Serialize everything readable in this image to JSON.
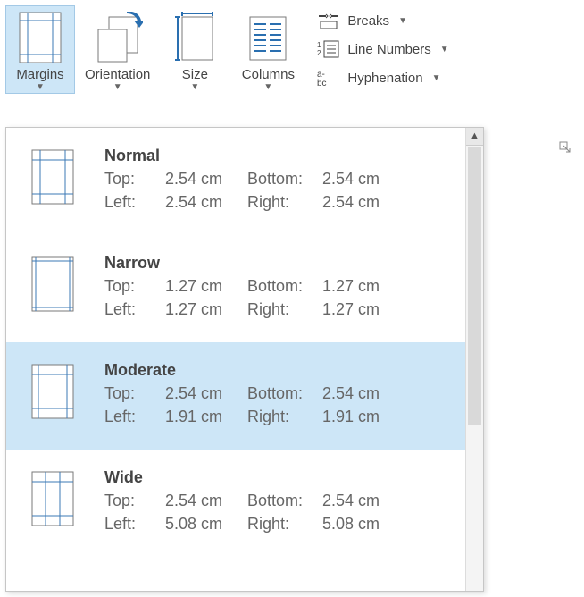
{
  "ribbon": {
    "margins": "Margins",
    "orientation": "Orientation",
    "size": "Size",
    "columns": "Columns",
    "breaks": "Breaks",
    "lineNumbers": "Line Numbers",
    "hyphenation": "Hyphenation"
  },
  "presets": [
    {
      "name": "Normal",
      "top": "2.54 cm",
      "bottom": "2.54 cm",
      "left": "2.54 cm",
      "right": "2.54 cm",
      "hover": false,
      "m": {
        "t": 12,
        "b": 12,
        "l": 10,
        "r": 10
      }
    },
    {
      "name": "Narrow",
      "top": "1.27 cm",
      "bottom": "1.27 cm",
      "left": "1.27 cm",
      "right": "1.27 cm",
      "hover": false,
      "m": {
        "t": 5,
        "b": 5,
        "l": 5,
        "r": 5
      }
    },
    {
      "name": "Moderate",
      "top": "2.54 cm",
      "bottom": "2.54 cm",
      "left": "1.91 cm",
      "right": "1.91 cm",
      "hover": true,
      "m": {
        "t": 12,
        "b": 12,
        "l": 8,
        "r": 8
      }
    },
    {
      "name": "Wide",
      "top": "2.54 cm",
      "bottom": "2.54 cm",
      "left": "5.08 cm",
      "right": "5.08 cm",
      "hover": false,
      "m": {
        "t": 12,
        "b": 12,
        "l": 16,
        "r": 16
      }
    }
  ],
  "labels": {
    "top": "Top:",
    "bottom": "Bottom:",
    "left": "Left:",
    "right": "Right:"
  }
}
